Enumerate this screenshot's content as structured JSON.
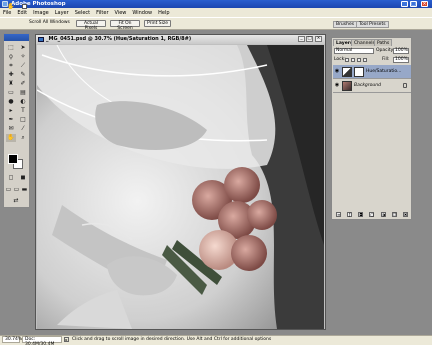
{
  "app": {
    "title": "Adobe Photoshop"
  },
  "menu": [
    "File",
    "Edit",
    "Image",
    "Layer",
    "Select",
    "Filter",
    "View",
    "Window",
    "Help"
  ],
  "options": {
    "scroll_all_label": "Scroll All Windows",
    "actual_pixels": "Actual Pixels",
    "fit_on_screen": "Fit On Screen",
    "print_size": "Print Size"
  },
  "dock_tabs": [
    "Brushes",
    "Tool Presets"
  ],
  "document": {
    "title": "_MG_0451.psd @ 30.7% (Hue/Saturation 1, RGB/8#)"
  },
  "layers_panel": {
    "tabs": [
      "Layers",
      "Channels",
      "Paths"
    ],
    "blend_mode": "Normal",
    "opacity_label": "Opacity:",
    "opacity_value": "100%",
    "lock_label": "Lock:",
    "fill_label": "Fill:",
    "fill_value": "100%",
    "layers": [
      {
        "name": "Hue/Saturatio...",
        "selected": true
      },
      {
        "name": "Background",
        "selected": false
      }
    ]
  },
  "status": {
    "zoom": "30.74%",
    "doc_info": "Doc: 30.4M/30.4M",
    "hint": "Click and drag to scroll image in desired direction.  Use Alt and Ctrl for additional options"
  },
  "icons": {
    "tools": [
      "marquee-icon",
      "move-icon",
      "lasso-icon",
      "magic-wand-icon",
      "crop-icon",
      "slice-icon",
      "healing-brush-icon",
      "brush-icon",
      "clone-stamp-icon",
      "history-brush-icon",
      "eraser-icon",
      "gradient-icon",
      "blur-icon",
      "dodge-icon",
      "path-select-icon",
      "type-icon",
      "pen-icon",
      "shape-icon",
      "notes-icon",
      "eyedropper-icon",
      "hand-icon",
      "zoom-icon"
    ]
  }
}
